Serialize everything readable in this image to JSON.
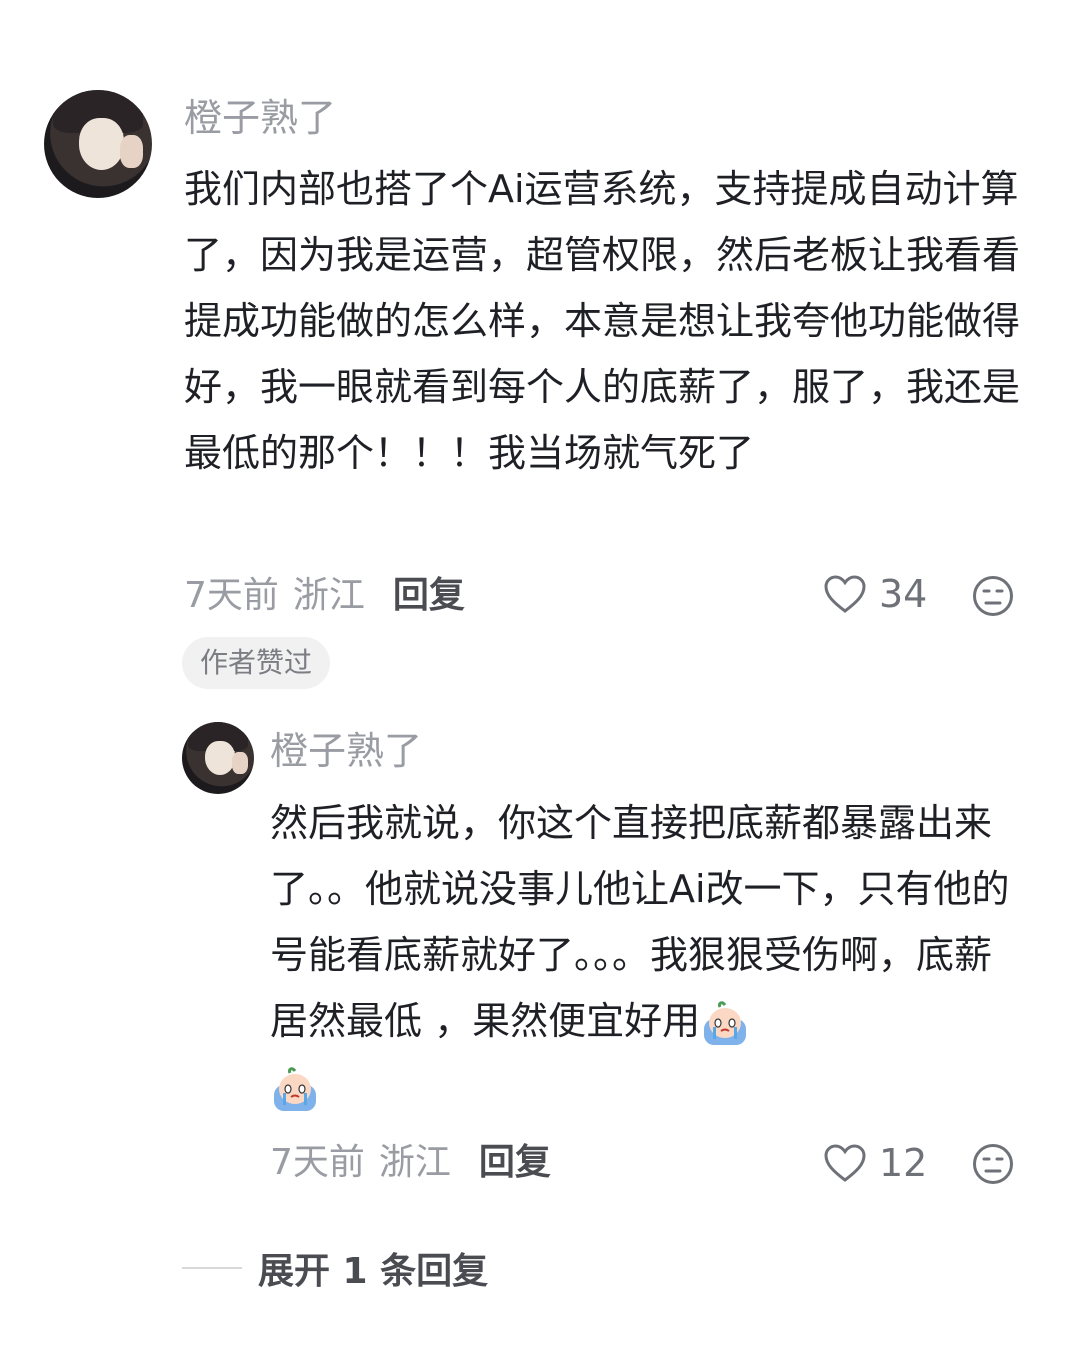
{
  "comment": {
    "username": "橙子熟了",
    "text": "我们内部也搭了个Ai运营系统，支持提成自动计算了，因为我是运营，超管权限，然后老板让我看看提成功能做的怎么样，本意是想让我夸他功能做得好，我一眼就看到每个人的底薪了，服了，我还是最低的那个！！！我当场就气死了",
    "time": "7天前",
    "location": "浙江",
    "reply_label": "回复",
    "likes": "34",
    "badge": "作者赞过"
  },
  "reply": {
    "username": "橙子熟了",
    "text": "然后我就说，你这个直接把底薪都暴露出来了。。他就说没事儿他让Ai改一下，只有他的号能看底薪就好了。。。我狠狠受伤啊，底薪居然最低 ，果然便宜好用",
    "emoji_1": "crying-face-emoji",
    "emoji_2": "crying-face-emoji",
    "time": "7天前",
    "location": "浙江",
    "reply_label": "回复",
    "likes": "12"
  },
  "expand_label": "展开 1 条回复",
  "icons": {
    "like": "heart-outline-icon",
    "dislike": "meh-face-icon"
  },
  "colors": {
    "secondary_text": "#9a9ca3",
    "primary_text": "#1f2026",
    "badge_bg": "#f1f1f2"
  }
}
